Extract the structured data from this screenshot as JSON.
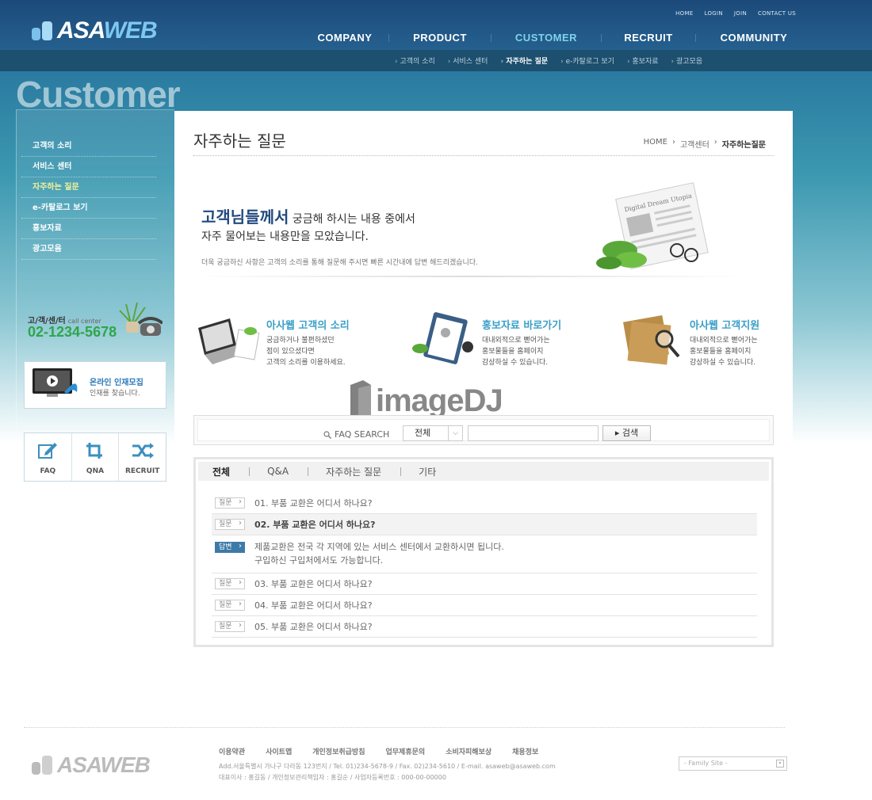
{
  "header": {
    "logo_prefix": "ASA",
    "logo_suffix": "WEB",
    "util_links": [
      "HOME",
      "LOGIN",
      "JOIN",
      "CONTACT US"
    ],
    "gnb": [
      "COMPANY",
      "PRODUCT",
      "CUSTOMER",
      "RECRUIT",
      "COMMUNITY"
    ],
    "gnb_active": "CUSTOMER",
    "snb": [
      "고객의 소리",
      "서비스 센터",
      "자주하는 질문",
      "e-카탈로그 보기",
      "홍보자료",
      "광고모음"
    ]
  },
  "section_title": "Customer",
  "sidebar": {
    "items": [
      {
        "label": "고객의 소리"
      },
      {
        "label": "서비스 센터"
      },
      {
        "label": "자주하는 질문"
      },
      {
        "label": "e-카탈로그 보기"
      },
      {
        "label": "홍보자료"
      },
      {
        "label": "광고모음"
      }
    ],
    "call_label": "고/객/센/터",
    "call_sub": "call center",
    "phone": "02-1234-5678",
    "recruit_title": "온라인 인재모집",
    "recruit_sub": "인재를 찾습니다.",
    "quick": [
      "FAQ",
      "QNA",
      "RECRUIT"
    ]
  },
  "content": {
    "title": "자주하는 질문",
    "breadcrumb": [
      "HOME",
      "고객센터",
      "자주하는질문"
    ],
    "intro_bold": "고객님들께서",
    "intro_rest": " 궁금해 하시는 내용 중에서",
    "intro_line2": "자주 물어보는 내용만을 모았습니다.",
    "intro_small": "더욱 궁금하신 사항은 고객의 소리를 통해 질문해 주시면 빠른 시간내에 답변 해드리겠습니다.",
    "newspaper_caption": "Digital Dream Utopia",
    "services": [
      {
        "title": "아사웹 고객의 소리",
        "desc": "궁금하거나 불편하셨던\n점이 있으셨다면\n고객의 소리를 이용하세요."
      },
      {
        "title": "홍보자료 바로가기",
        "desc": "대내외적으로 뻗어가는\n홍보물들을 홈페이지\n감상하실 수 있습니다."
      },
      {
        "title": "아사웹 고객지원",
        "desc": "대내외적으로 뻗어가는\n홍보물들을 홈페이지\n감상하실 수 있습니다."
      }
    ]
  },
  "watermark": "imageDJ",
  "search": {
    "label": "FAQ SEARCH",
    "select_value": "전체",
    "input_value": "",
    "button": "검색"
  },
  "faq": {
    "tabs": [
      "전체",
      "Q&A",
      "자주하는 질문",
      "기타"
    ],
    "question_tag": "질문",
    "answer_tag": "답변",
    "items": [
      {
        "q": "01. 부품 교환은 어디서 하나요?"
      },
      {
        "q": "02. 부품 교환은 어디서 하나요?",
        "open": true,
        "answer": [
          "제품교환은 전국 각 지역에 있는 서비스 센터에서 교환하시면 됩니다.",
          "구입하신 구입처에서도 가능합니다."
        ]
      },
      {
        "q": "03. 부품 교환은 어디서 하나요?"
      },
      {
        "q": "04. 부품 교환은 어디서 하나요?"
      },
      {
        "q": "05. 부품 교환은 어디서 하나요?"
      }
    ]
  },
  "footer": {
    "links": [
      "이용약관",
      "사이트맵",
      "개인정보취급방침",
      "업무제휴문의",
      "소비자피해보상",
      "채용정보"
    ],
    "address": "Add.서울특별시 가나구 다라동 123번지  / Tel. 01)234-5678-9  / Fax. 02)234-5610  / E-mail. asaweb@asaweb.com",
    "ceo": "대표이사 : 홍길동 / 개인정보관리책임자 : 홍길순 / 사업자등록번호 : 000-00-00000",
    "family_site": "- Family Site -"
  },
  "colors": {
    "header_bg": "#1c4a7a",
    "accent_cyan": "#7fd3ea",
    "phone_green": "#2ea64a",
    "answer_tag": "#3d7aa8"
  }
}
